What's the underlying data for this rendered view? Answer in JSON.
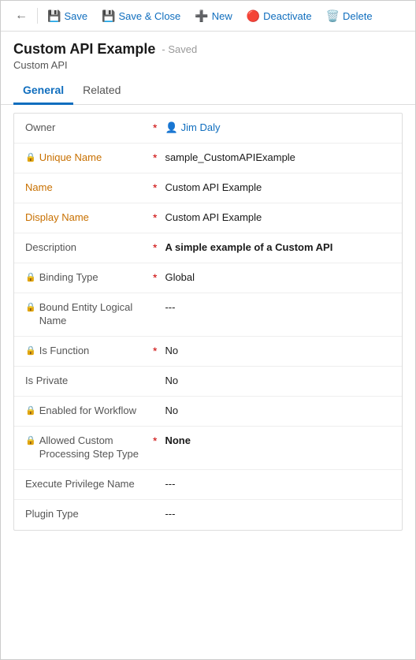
{
  "toolbar": {
    "back_label": "←",
    "save_label": "Save",
    "save_close_label": "Save & Close",
    "new_label": "New",
    "deactivate_label": "Deactivate",
    "delete_label": "Delete"
  },
  "header": {
    "title": "Custom API Example",
    "saved_status": "- Saved",
    "subtitle": "Custom API"
  },
  "tabs": [
    {
      "id": "general",
      "label": "General",
      "active": true
    },
    {
      "id": "related",
      "label": "Related",
      "active": false
    }
  ],
  "form": {
    "fields": [
      {
        "label": "Owner",
        "locked": false,
        "required": true,
        "value": "Jim Daly",
        "type": "user-link"
      },
      {
        "label": "Unique Name",
        "locked": true,
        "required": true,
        "value": "sample_CustomAPIExample",
        "type": "orange-label"
      },
      {
        "label": "Name",
        "locked": false,
        "required": true,
        "value": "Custom API Example",
        "type": "orange-label"
      },
      {
        "label": "Display Name",
        "locked": false,
        "required": true,
        "value": "Custom API Example",
        "type": "orange-label"
      },
      {
        "label": "Description",
        "locked": false,
        "required": true,
        "value": "A simple example of a Custom API",
        "type": "bold-value",
        "orange-label": false
      },
      {
        "label": "Binding Type",
        "locked": true,
        "required": true,
        "value": "Global",
        "type": "normal"
      },
      {
        "label": "Bound Entity Logical Name",
        "locked": true,
        "required": false,
        "value": "---",
        "type": "normal",
        "multiline": true
      },
      {
        "label": "Is Function",
        "locked": true,
        "required": true,
        "value": "No",
        "type": "normal"
      },
      {
        "label": "Is Private",
        "locked": false,
        "required": false,
        "value": "No",
        "type": "normal"
      },
      {
        "label": "Enabled for Workflow",
        "locked": true,
        "required": false,
        "value": "No",
        "type": "normal"
      },
      {
        "label": "Allowed Custom Processing Step Type",
        "locked": true,
        "required": true,
        "value": "None",
        "type": "bold-value",
        "multiline": true
      },
      {
        "label": "Execute Privilege Name",
        "locked": false,
        "required": false,
        "value": "---",
        "type": "normal",
        "multiline": true
      },
      {
        "label": "Plugin Type",
        "locked": false,
        "required": false,
        "value": "---",
        "type": "normal"
      }
    ]
  }
}
